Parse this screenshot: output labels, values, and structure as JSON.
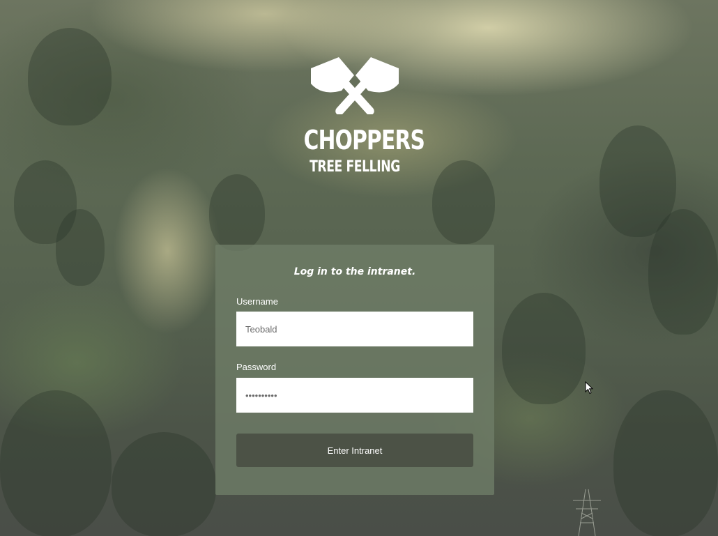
{
  "brand": {
    "name": "CHOPPERS",
    "tagline": "TREE FELLING",
    "logo_icon": "crossed-axes-icon"
  },
  "login": {
    "title": "Log in to the intranet.",
    "username_label": "Username",
    "username_value": "Teobald",
    "password_label": "Password",
    "password_value": "••••••••••",
    "submit_label": "Enter Intranet"
  },
  "colors": {
    "panel": "#707e68",
    "button": "#4c5246",
    "text": "#ffffff"
  }
}
